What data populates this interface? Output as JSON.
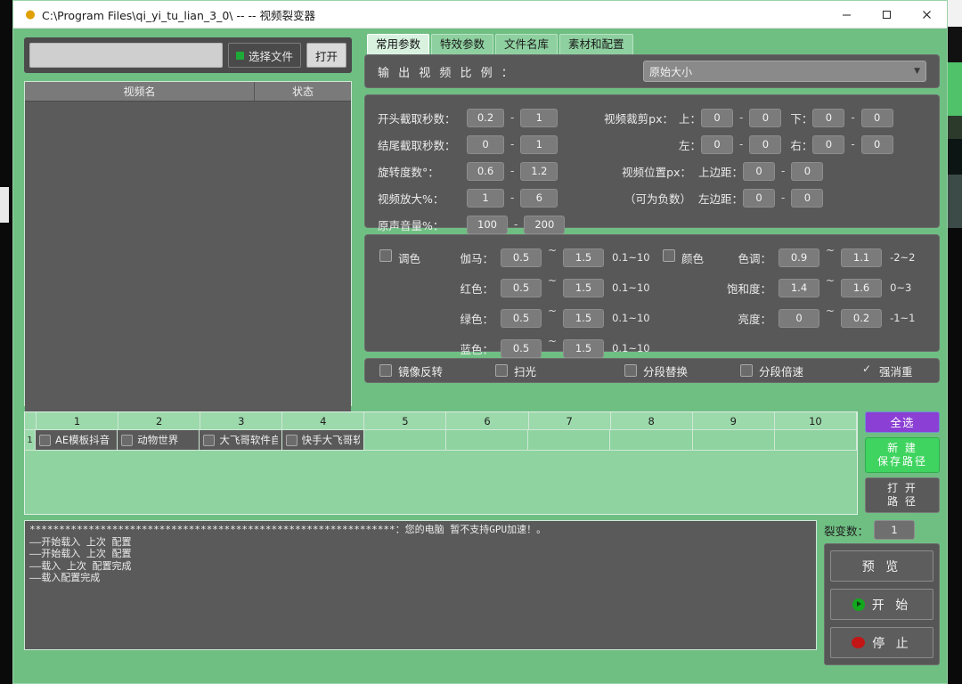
{
  "window": {
    "title": "C:\\Program Files\\qi_yi_tu_lian_3_0\\ -- -- 视频裂变器",
    "minimize": "–",
    "maximize": "□",
    "close": "✕"
  },
  "filebar": {
    "path_value": "",
    "path_placeholder": "",
    "choose_label": "选择文件",
    "open_label": "打开"
  },
  "list": {
    "col_name": "视频名",
    "col_status": "状态"
  },
  "tabs": [
    {
      "label": "常用参数",
      "active": true
    },
    {
      "label": "特效参数",
      "active": false
    },
    {
      "label": "文件名库",
      "active": false
    },
    {
      "label": "素材和配置",
      "active": false
    }
  ],
  "ratio": {
    "label": "输 出 视 频 比 例 ：",
    "selected": "原始大小",
    "caret": "▼"
  },
  "nums": {
    "left": [
      {
        "label": "开头截取秒数：",
        "min": "0.2",
        "max": "1"
      },
      {
        "label": "结尾截取秒数：",
        "min": "0",
        "max": "1"
      },
      {
        "label": "旋转度数°：",
        "min": "0.6",
        "max": "1.2"
      },
      {
        "label": "视频放大%：",
        "min": "1",
        "max": "6"
      },
      {
        "label": "原声音量%：",
        "min": "100",
        "max": "200"
      }
    ],
    "crop_label": "视频裁剪px：",
    "crop": [
      {
        "label": "上：",
        "min": "0",
        "max": "0",
        "label2": "下：",
        "min2": "0",
        "max2": "0"
      },
      {
        "label": "左：",
        "min": "0",
        "max": "0",
        "label2": "右：",
        "min2": "0",
        "max2": "0"
      }
    ],
    "pos_label": "视频位置px：",
    "pos_note": "（可为负数）",
    "pos": [
      {
        "label": "上边距：",
        "min": "0",
        "max": "0"
      },
      {
        "label": "左边距：",
        "min": "0",
        "max": "0"
      }
    ],
    "dash": "-"
  },
  "colorpanel": {
    "tone_check_label": "调色",
    "tone_checked": false,
    "tone_rows": [
      {
        "label": "伽马：",
        "min": "0.5",
        "max": "1.5",
        "hint": "0.1~10"
      },
      {
        "label": "红色：",
        "min": "0.5",
        "max": "1.5",
        "hint": "0.1~10"
      },
      {
        "label": "绿色：",
        "min": "0.5",
        "max": "1.5",
        "hint": "0.1~10"
      },
      {
        "label": "蓝色：",
        "min": "0.5",
        "max": "1.5",
        "hint": "0.1~10"
      }
    ],
    "color_check_label": "颜色",
    "color_checked": false,
    "color_rows": [
      {
        "label": "色调：",
        "min": "0.9",
        "max": "1.1",
        "hint": "-2~2"
      },
      {
        "label": "饱和度：",
        "min": "1.4",
        "max": "1.6",
        "hint": "0~3"
      },
      {
        "label": "亮度：",
        "min": "0",
        "max": "0.2",
        "hint": "-1~1"
      }
    ],
    "tilde": "~"
  },
  "options": [
    {
      "label": "镜像反转",
      "checked": false
    },
    {
      "label": "扫光",
      "checked": false
    },
    {
      "label": "分段替换",
      "checked": false
    },
    {
      "label": "分段倍速",
      "checked": false
    },
    {
      "label": "强消重",
      "checked": true
    }
  ],
  "grid": {
    "columns": [
      "1",
      "2",
      "3",
      "4",
      "5",
      "6",
      "7",
      "8",
      "9",
      "10"
    ],
    "row_number": "1",
    "cells": [
      {
        "text": "AE模板抖音",
        "checked": false,
        "filled": true
      },
      {
        "text": "动物世界",
        "checked": false,
        "filled": true
      },
      {
        "text": "大飞哥软件自",
        "checked": false,
        "filled": true
      },
      {
        "text": "快手大飞哥软",
        "checked": false,
        "filled": true
      },
      {
        "text": "",
        "checked": false,
        "filled": false
      },
      {
        "text": "",
        "checked": false,
        "filled": false
      },
      {
        "text": "",
        "checked": false,
        "filled": false
      },
      {
        "text": "",
        "checked": false,
        "filled": false
      },
      {
        "text": "",
        "checked": false,
        "filled": false
      },
      {
        "text": "",
        "checked": false,
        "filled": false
      }
    ]
  },
  "side_buttons": {
    "select_all": "全选",
    "new_path_line1": "新 建",
    "new_path_line2": "保存路径",
    "open_path_line1": "打 开",
    "open_path_line2": "路 径"
  },
  "log": {
    "lines": [
      "**************************************************************：您的电脑 暂不支持GPU加速！。",
      "——开始载入 上次 配置",
      "——开始载入 上次 配置",
      "——载入 上次 配置完成",
      "——载入配置完成"
    ]
  },
  "run": {
    "fission_label": "裂变数：",
    "fission_value": "1",
    "preview": "预 览",
    "start": "开 始",
    "stop": "停 止"
  },
  "colors": {
    "window_green": "#6fbf83",
    "panel_gray": "#585858",
    "accent_purple": "#8b3fd4",
    "accent_green": "#3fd45f",
    "start_green": "#13a81e",
    "stop_red": "#c31515"
  }
}
